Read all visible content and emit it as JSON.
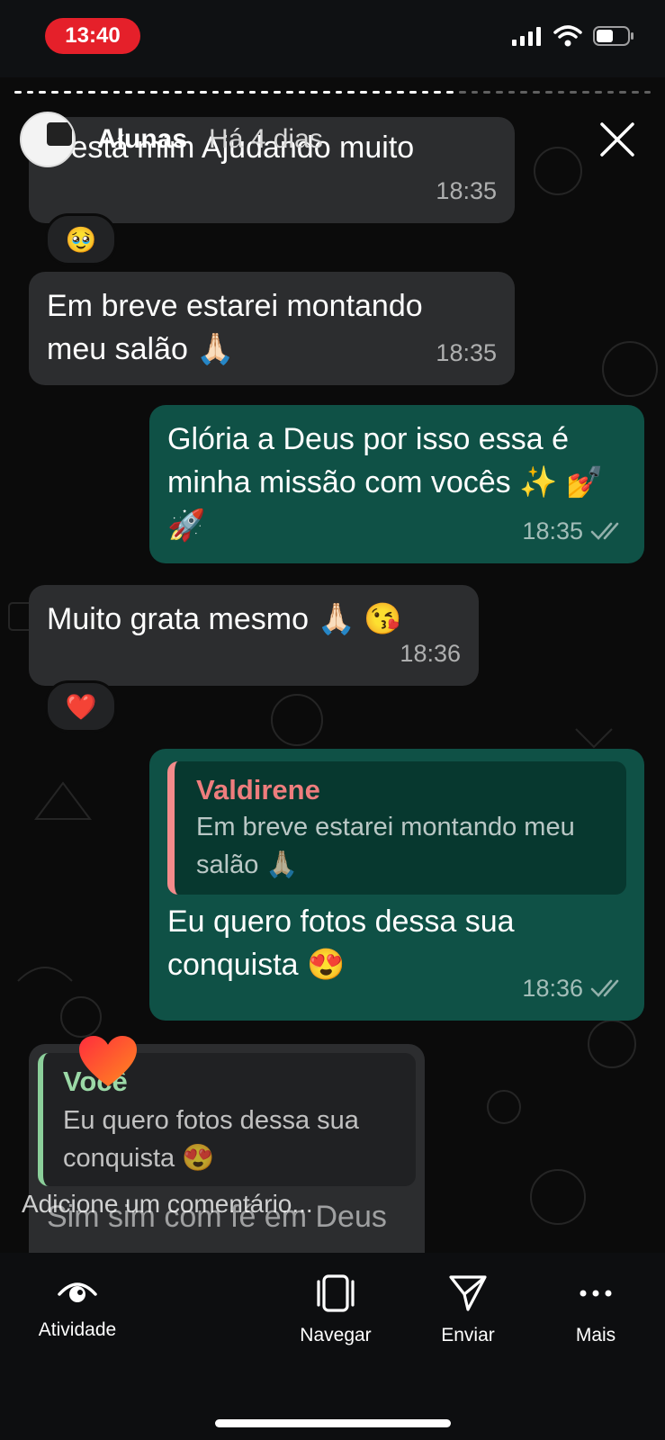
{
  "status": {
    "time": "13:40"
  },
  "story": {
    "author": "Alunas",
    "age": "Há 4 dias"
  },
  "messages": [
    {
      "text": "c está mim Ajudando muito",
      "time": "18:35"
    },
    {
      "text": "Em breve estarei montando meu salão 🙏🏻",
      "time": "18:35"
    },
    {
      "text": "Glória a Deus por isso essa é minha missão com vocês ✨ 💅 🚀",
      "time": "18:35"
    },
    {
      "text": "Muito grata mesmo 🙏🏻 😘",
      "time": "18:36"
    },
    {
      "reply_name": "Valdirene",
      "reply_text": "Em breve estarei montando meu salão 🙏🏻",
      "text": "Eu quero fotos dessa sua conquista 😍",
      "time": "18:36"
    },
    {
      "reply_name": "Você",
      "reply_text": "Eu quero fotos dessa sua conquista 😍",
      "text": "Sim sim com fé em Deus"
    }
  ],
  "reactions": [
    "🥹",
    "❤️"
  ],
  "comment": {
    "placeholder": "Adicione um comentário..."
  },
  "bottom_nav": [
    {
      "label": "Atividade",
      "icon": "eye-icon"
    },
    {
      "label": "Navegar",
      "icon": "navigate-icon"
    },
    {
      "label": "Enviar",
      "icon": "send-icon"
    },
    {
      "label": "Mais",
      "icon": "more-icon"
    }
  ]
}
